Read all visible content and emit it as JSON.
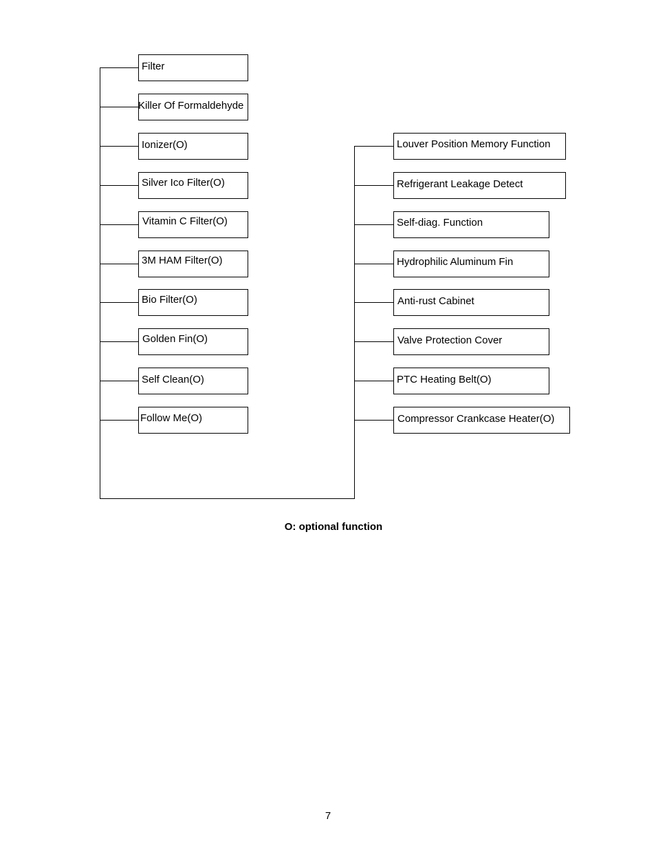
{
  "diagram": {
    "left_branch": [
      {
        "label": "Filter"
      },
      {
        "label": "Killer Of Formaldehyde"
      },
      {
        "label": "Ionizer(O)"
      },
      {
        "label": "Silver Ico Filter(O)"
      },
      {
        "label": "Vitamin C Filter(O)"
      },
      {
        "label": "3M HAM Filter(O)"
      },
      {
        "label": "Bio Filter(O)"
      },
      {
        "label": "Golden Fin(O)"
      },
      {
        "label": "Self Clean(O)"
      },
      {
        "label": "Follow Me(O)"
      }
    ],
    "right_branch": [
      {
        "label": "Louver Position Memory Function"
      },
      {
        "label": "Refrigerant Leakage Detect"
      },
      {
        "label": "Self-diag. Function"
      },
      {
        "label": "Hydrophilic Aluminum Fin"
      },
      {
        "label": "Anti-rust Cabinet"
      },
      {
        "label": "Valve Protection Cover"
      },
      {
        "label": "PTC Heating Belt(O)"
      },
      {
        "label": "Compressor Crankcase Heater(O)"
      }
    ]
  },
  "legend_note": "O: optional function",
  "page_number": "7"
}
